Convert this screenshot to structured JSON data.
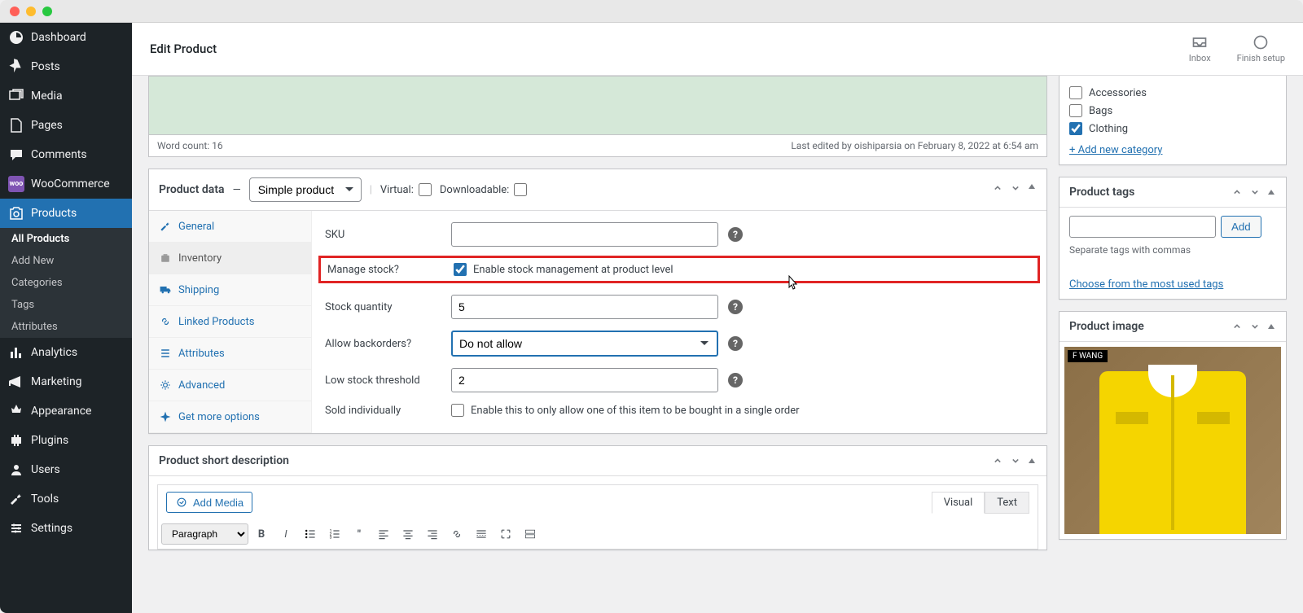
{
  "page_title": "Edit Product",
  "topbar_actions": {
    "inbox": "Inbox",
    "finish_setup": "Finish setup"
  },
  "sidebar": {
    "dashboard": "Dashboard",
    "posts": "Posts",
    "media": "Media",
    "pages": "Pages",
    "comments": "Comments",
    "woocommerce": "WooCommerce",
    "products": "Products",
    "submenu": {
      "all_products": "All Products",
      "add_new": "Add New",
      "categories": "Categories",
      "tags": "Tags",
      "attributes": "Attributes"
    },
    "analytics": "Analytics",
    "marketing": "Marketing",
    "appearance": "Appearance",
    "plugins": "Plugins",
    "users": "Users",
    "tools": "Tools",
    "settings": "Settings"
  },
  "editor_status": {
    "word_count": "Word count: 16",
    "last_edited": "Last edited by oishiparsia on February 8, 2022 at 6:54 am"
  },
  "product_data": {
    "title": "Product data",
    "type_selected": "Simple product",
    "virtual_label": "Virtual:",
    "downloadable_label": "Downloadable:",
    "tabs": {
      "general": "General",
      "inventory": "Inventory",
      "shipping": "Shipping",
      "linked": "Linked Products",
      "attributes": "Attributes",
      "advanced": "Advanced",
      "get_more": "Get more options"
    },
    "fields": {
      "sku_label": "SKU",
      "sku_value": "",
      "manage_stock_label": "Manage stock?",
      "manage_stock_desc": "Enable stock management at product level",
      "stock_qty_label": "Stock quantity",
      "stock_qty_value": "5",
      "backorders_label": "Allow backorders?",
      "backorders_value": "Do not allow",
      "low_stock_label": "Low stock threshold",
      "low_stock_value": "2",
      "sold_individually_label": "Sold individually",
      "sold_individually_desc": "Enable this to only allow one of this item to be bought in a single order"
    }
  },
  "short_desc": {
    "title": "Product short description",
    "add_media": "Add Media",
    "tab_visual": "Visual",
    "tab_text": "Text",
    "format_selected": "Paragraph"
  },
  "categories": {
    "items": [
      {
        "label": "Accessories",
        "checked": false
      },
      {
        "label": "Bags",
        "checked": false
      },
      {
        "label": "Clothing",
        "checked": true
      }
    ],
    "add_new": "+ Add new category"
  },
  "tags_panel": {
    "title": "Product tags",
    "add_btn": "Add",
    "separate": "Separate tags with commas",
    "choose": "Choose from the most used tags"
  },
  "image_panel": {
    "title": "Product image",
    "brand": "F WANG"
  }
}
